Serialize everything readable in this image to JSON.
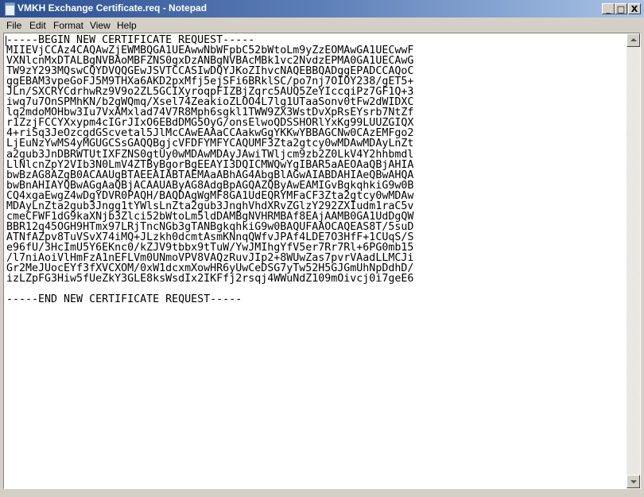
{
  "window": {
    "title": "VMKH Exchange Certificate.req - Notepad",
    "minimize": "_",
    "maximize": "□",
    "close": "X"
  },
  "menu": [
    {
      "label": "File"
    },
    {
      "label": "Edit"
    },
    {
      "label": "Format"
    },
    {
      "label": "View"
    },
    {
      "label": "Help"
    }
  ],
  "editor": {
    "content": "-----BEGIN NEW CERTIFICATE REQUEST-----\nMIIEVjCCAz4CAQAwZjEWMBQGA1UEAwwNbWFpbC52bWtoLm9yZzEOMAwGA1UECwwF\nVXNlcnMxDTALBgNVBAoMBFZNS0gxDzANBgNVBAcMBk1vc2NvdzEPMA0GA1UECAwG\nTW9zY293MQswCQYDVQQGEwJSVTCCASIwDQYJKoZIhvcNAQEBBQADggEPADCCAQoC\nggEBAM3vpeGoFJ5M9THXa6AKD2pxMfj5ejSFi6BRklSC/po7nj7OIOY238/gET5+\nJLn/SXCRYCdrhwRz9V9o2ZL5GCIXyroqpFIZBjZqrc5AUQ5ZeYIccqiPz7GF1Q+3\niwq7u7OnSPMhKN/b2gWQmq/Xsel74ZeakioZLOO4L7lg1UTaaSonv0tFw2dWIDXC\nlq2mdoMOHbw3Iu7VxAMxlad74V7R8Mph6sgkl1TWW9ZX3WstDvXpRsEYsrb7NtZf\nr1ZzjFCCYXxypm4cIGrJIxO6EBdDMG5OyG/onsElwoQDSSHORlYxKg99LUUZGIQX\n4+riSq3JeOzcgdGScvetal5JlMcCAwEAAaCCAakwGgYKKwYBBAGCNw0CAzEMFgo2\nLjEuNzYwMS4yMGUGCSsGAQQBgjcVFDFYMFYCAQUMF3Zta2gtcy0wMDAwMDAyLnZt\na2gub3JnDBRWTUtIXFZNS0gtUy0wMDAwMDAyJAwiTWljcm9zb2Z0LkV4Y2hhbmdl\nLlNlcnZpY2VIb3N0LmV4ZTByBgorBgEEAYI3DQICMWQwYgIBAR5aAEOAaQBjAHIA\nbwBzAG8AZgB0ACAAUgBTAEEAIABTAEMAaABhAG4AbgBlAGwAIABDAHIAeQBwAHQA\nbwBnAHIAYQBwAGgAaQBjACAAUAByAG8AdgBpAGQAZQByAwEAMIGvBgkqhkiG9w0B\nCQ4xgaEwgZ4wDgYDVR0PAQH/BAQDAgWgMF8GA1UdEQRYMFaCF3Zta2gtcy0wMDAw\nMDAyLnZta2gub3Jngg1tYWlsLnZta2gub3JnghVhdXRvZGlzY292ZXIudm1raC5v\ncmeCFWF1dG9kaXNjb3Zlci52bWtoLm5ldDAMBgNVHRMBAf8EAjAAMB0GA1UdDgQW\nBBR12q45OGH9HTmx97LRjTncNGb3gTANBgkqhkiG9w0BAQUFAAOCAQEAS8T/5suD\nATNfAZpv8TuVSvX74iMQ+JLzkh0dcmtAsmKNnqQWfvJPAf4LDE7O3HfF+1CUqS/S\ne96fU/3HcImU5Y6EKnc0/kZJV9tbbx9tTuW/YwJMIhgYfV5er7Rr7Rl+6PG0mb15\n/l7niAoiVlHmFzA1nEFLVm0UNmoVPV8VAQzRuvJIp2+8WUwZas7pvrVAadLLMCJi\nGr2MeJUocEYf3fXVCXOM/0xW1dcxmXowHR6yUwCeDSG7yTw52H5GJGmUhNpDdhD/\nizLZpFG3Hiw5fUeZkY3GLE8ksWsdIx2IKFfj2rsqj4WWuNdZ109mOivcj0i7geE6\n\n-----END NEW CERTIFICATE REQUEST-----"
  }
}
